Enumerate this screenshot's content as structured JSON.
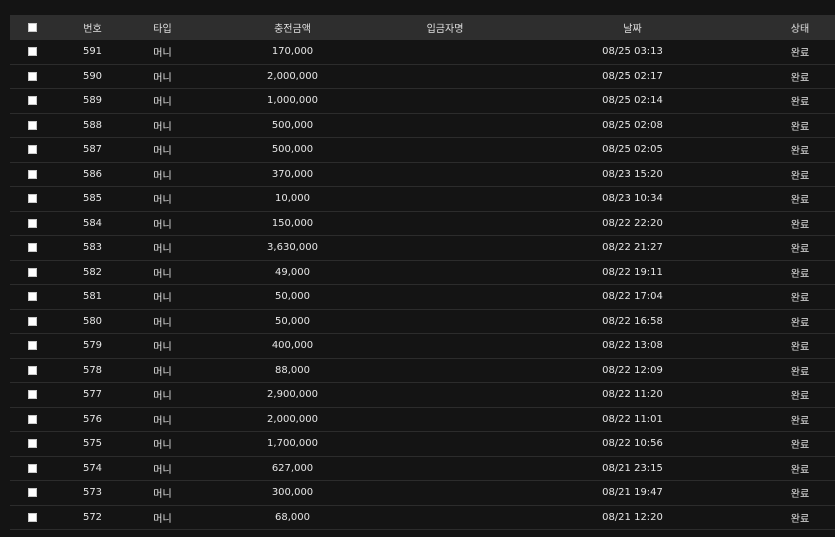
{
  "table": {
    "headers": {
      "no": "번호",
      "type": "타입",
      "amount": "충전금액",
      "depositor": "입금자명",
      "date": "날짜",
      "status": "상태"
    },
    "rows": [
      {
        "no": "591",
        "type": "머니",
        "amount": "170,000",
        "depositor": "",
        "date": "08/25 03:13",
        "status": "완료"
      },
      {
        "no": "590",
        "type": "머니",
        "amount": "2,000,000",
        "depositor": "",
        "date": "08/25 02:17",
        "status": "완료"
      },
      {
        "no": "589",
        "type": "머니",
        "amount": "1,000,000",
        "depositor": "",
        "date": "08/25 02:14",
        "status": "완료"
      },
      {
        "no": "588",
        "type": "머니",
        "amount": "500,000",
        "depositor": "",
        "date": "08/25 02:08",
        "status": "완료"
      },
      {
        "no": "587",
        "type": "머니",
        "amount": "500,000",
        "depositor": "",
        "date": "08/25 02:05",
        "status": "완료"
      },
      {
        "no": "586",
        "type": "머니",
        "amount": "370,000",
        "depositor": "",
        "date": "08/23 15:20",
        "status": "완료"
      },
      {
        "no": "585",
        "type": "머니",
        "amount": "10,000",
        "depositor": "",
        "date": "08/23 10:34",
        "status": "완료"
      },
      {
        "no": "584",
        "type": "머니",
        "amount": "150,000",
        "depositor": "",
        "date": "08/22 22:20",
        "status": "완료"
      },
      {
        "no": "583",
        "type": "머니",
        "amount": "3,630,000",
        "depositor": "",
        "date": "08/22 21:27",
        "status": "완료"
      },
      {
        "no": "582",
        "type": "머니",
        "amount": "49,000",
        "depositor": "",
        "date": "08/22 19:11",
        "status": "완료"
      },
      {
        "no": "581",
        "type": "머니",
        "amount": "50,000",
        "depositor": "",
        "date": "08/22 17:04",
        "status": "완료"
      },
      {
        "no": "580",
        "type": "머니",
        "amount": "50,000",
        "depositor": "",
        "date": "08/22 16:58",
        "status": "완료"
      },
      {
        "no": "579",
        "type": "머니",
        "amount": "400,000",
        "depositor": "",
        "date": "08/22 13:08",
        "status": "완료"
      },
      {
        "no": "578",
        "type": "머니",
        "amount": "88,000",
        "depositor": "",
        "date": "08/22 12:09",
        "status": "완료"
      },
      {
        "no": "577",
        "type": "머니",
        "amount": "2,900,000",
        "depositor": "",
        "date": "08/22 11:20",
        "status": "완료"
      },
      {
        "no": "576",
        "type": "머니",
        "amount": "2,000,000",
        "depositor": "",
        "date": "08/22 11:01",
        "status": "완료"
      },
      {
        "no": "575",
        "type": "머니",
        "amount": "1,700,000",
        "depositor": "",
        "date": "08/22 10:56",
        "status": "완료"
      },
      {
        "no": "574",
        "type": "머니",
        "amount": "627,000",
        "depositor": "",
        "date": "08/21 23:15",
        "status": "완료"
      },
      {
        "no": "573",
        "type": "머니",
        "amount": "300,000",
        "depositor": "",
        "date": "08/21 19:47",
        "status": "완료"
      },
      {
        "no": "572",
        "type": "머니",
        "amount": "68,000",
        "depositor": "",
        "date": "08/21 12:20",
        "status": "완료"
      }
    ]
  }
}
